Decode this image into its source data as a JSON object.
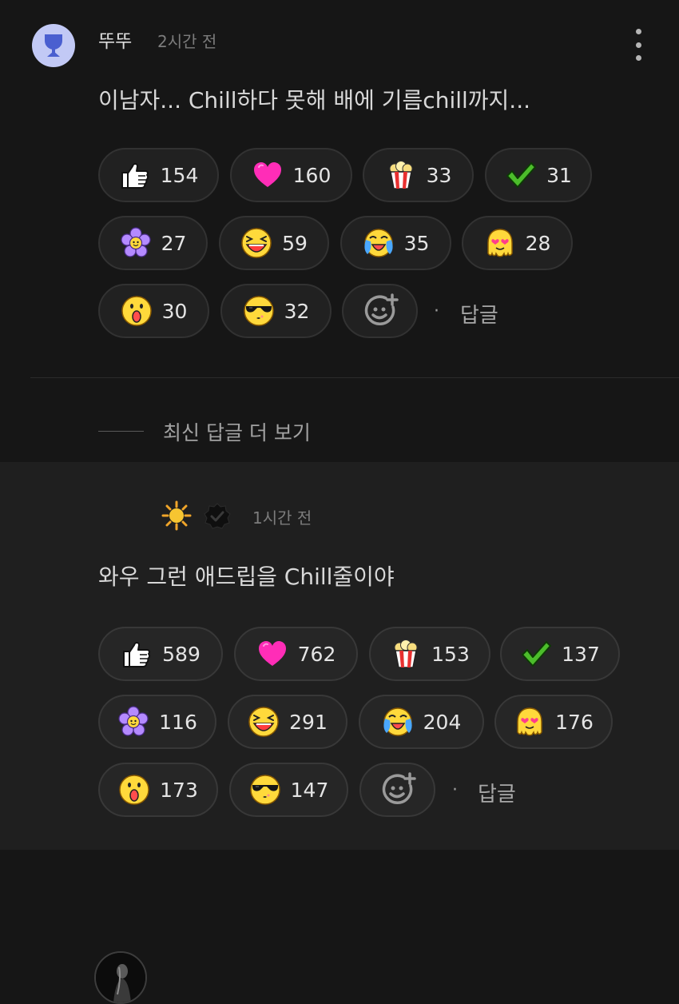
{
  "comment": {
    "username": "뚜뚜",
    "time": "2시간 전",
    "text": "이남자... Chill하다 못해 배에 기름chill까지...",
    "reactions": [
      {
        "icon": "thumbs-up",
        "count": "154"
      },
      {
        "icon": "heart",
        "count": "160"
      },
      {
        "icon": "popcorn",
        "count": "33"
      },
      {
        "icon": "check",
        "count": "31"
      },
      {
        "icon": "flower",
        "count": "27"
      },
      {
        "icon": "laughing",
        "count": "59"
      },
      {
        "icon": "crying",
        "count": "35"
      },
      {
        "icon": "heart-eyes",
        "count": "28"
      },
      {
        "icon": "surprised",
        "count": "30"
      },
      {
        "icon": "sunglasses",
        "count": "32"
      }
    ],
    "reply_label": "답글",
    "separator": "·"
  },
  "more_replies_label": "최신 답글 더 보기",
  "reply": {
    "username_emoji": "sun",
    "verified_icon": "verified-badge",
    "time": "1시간 전",
    "text": "와우 그런 애드립을 Chill줄이야",
    "reactions": [
      {
        "icon": "thumbs-up",
        "count": "589"
      },
      {
        "icon": "heart",
        "count": "762"
      },
      {
        "icon": "popcorn",
        "count": "153"
      },
      {
        "icon": "check",
        "count": "137"
      },
      {
        "icon": "flower",
        "count": "116"
      },
      {
        "icon": "laughing",
        "count": "291"
      },
      {
        "icon": "crying",
        "count": "204"
      },
      {
        "icon": "heart-eyes",
        "count": "176"
      },
      {
        "icon": "surprised",
        "count": "173"
      },
      {
        "icon": "sunglasses",
        "count": "147"
      }
    ],
    "reply_label": "답글",
    "separator": "·"
  },
  "colors": {
    "background": "#161616",
    "reply_background": "#1f1f1f",
    "pill": "#212121",
    "avatar": "#c2c9f5",
    "avatar_icon": "#4a5fd0"
  }
}
